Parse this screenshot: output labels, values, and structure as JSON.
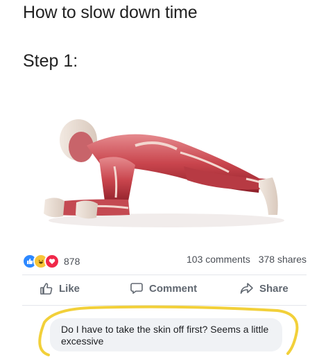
{
  "post": {
    "title": "How to slow down time",
    "step": "Step 1:"
  },
  "stats": {
    "reaction_icons": [
      "like-icon",
      "haha-icon",
      "love-icon"
    ],
    "reaction_count": "878",
    "comments": "103 comments",
    "shares": "378 shares"
  },
  "actions": {
    "like": "Like",
    "comment": "Comment",
    "share": "Share"
  },
  "comment": {
    "text": "Do I have to take the skin off first? Seems a little excessive"
  },
  "colors": {
    "highlight": "#f2d03a",
    "like": "#2d88ff",
    "love": "#f02849",
    "haha": "#f7c437",
    "muscle": "#c9454d"
  }
}
